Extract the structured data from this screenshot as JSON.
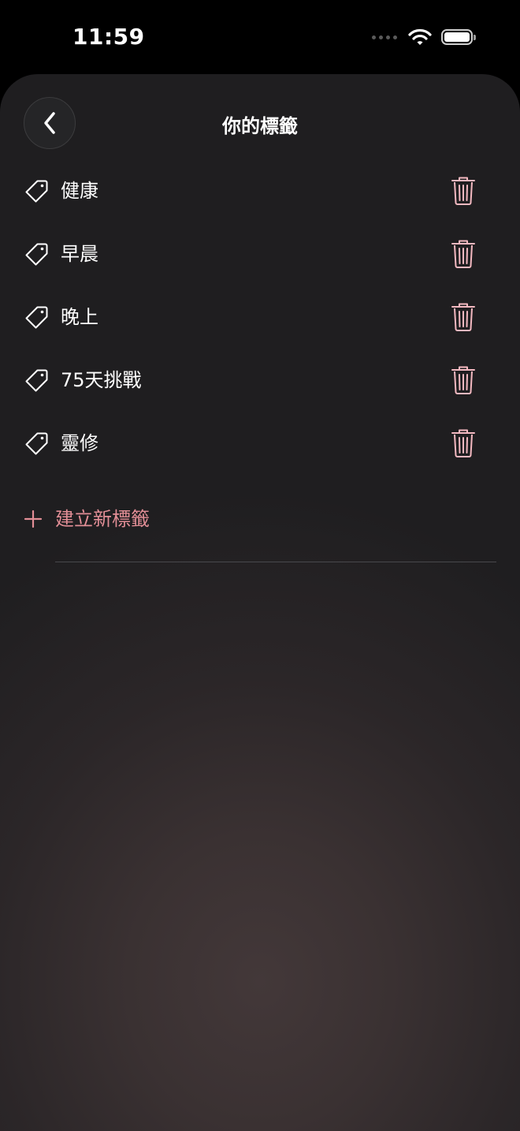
{
  "status_bar": {
    "time": "11:59"
  },
  "header": {
    "title": "你的標籤",
    "back_icon": "chevron-left-icon"
  },
  "tags": [
    {
      "label": "健康"
    },
    {
      "label": "早晨"
    },
    {
      "label": "晚上"
    },
    {
      "label": "75天挑戰"
    },
    {
      "label": "靈修"
    }
  ],
  "actions": {
    "new_tag_label": "建立新標籤"
  },
  "icons": {
    "tag": "tag-icon",
    "delete": "trash-icon",
    "add": "plus-icon"
  },
  "colors": {
    "accent": "#e28e96",
    "trash": "#f4b9c1",
    "text": "#ffffff"
  }
}
